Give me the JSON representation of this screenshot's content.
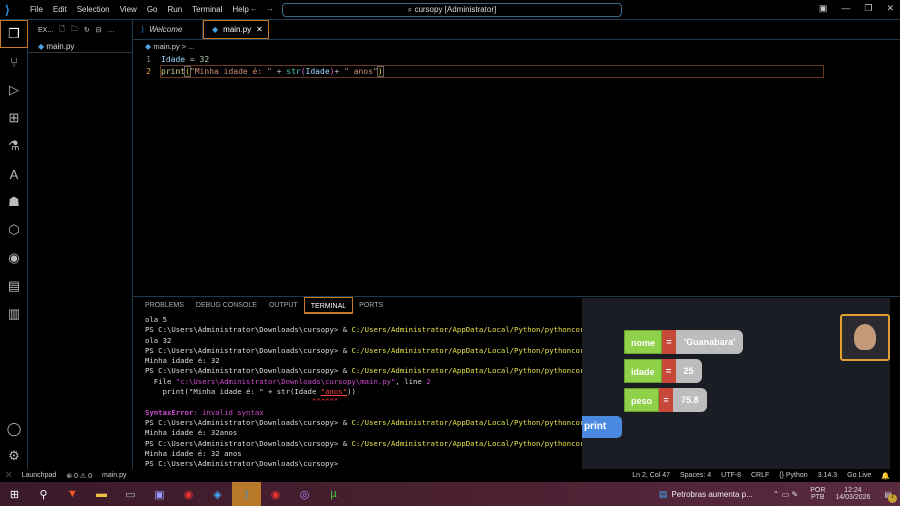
{
  "titlebar": {
    "menu": [
      "File",
      "Edit",
      "Selection",
      "View",
      "Go",
      "Run",
      "Terminal",
      "Help"
    ],
    "search": "cursopy [Administrator]"
  },
  "explorer": {
    "title": "EX...",
    "files": [
      "main.py"
    ]
  },
  "tabs": [
    {
      "label": "Welcome"
    },
    {
      "label": "main.py",
      "active": true
    }
  ],
  "breadcrumb": "main.py > ...",
  "code": {
    "line1_no": "1",
    "line2_no": "2",
    "l1": {
      "var": "Idade",
      "op": " = ",
      "num": "32"
    },
    "l2": {
      "fn": "print",
      "p1": "(",
      "s1": "\"Minha idade é: \"",
      "op": " + ",
      "fn2": "str",
      "p2": "(",
      "var": "Idade",
      "p3": ")",
      "op2": "+ ",
      "s2": "\" anos\"",
      "p4": ")"
    }
  },
  "panel": {
    "tabs": [
      "PROBLEMS",
      "DEBUG CONSOLE",
      "OUTPUT",
      "TERMINAL",
      "PORTS"
    ],
    "active": "TERMINAL"
  },
  "terminal": {
    "prompt": "PS C:\\Users\\Administrator\\Downloads\\cursopy> ",
    "amp": "& ",
    "path": "C:/Users/Administrator/AppData/Local/Python/pythoncore-3.",
    "out1": "ola 5",
    "out2": "ola 32",
    "out3": "Minha idade é: 32",
    "file_pre": "  File ",
    "file_path": "\"c:\\Users\\Administrator\\Downloads\\cursopy\\main.py\"",
    "file_mid": ", line ",
    "file_line": "2",
    "err_code_pre": "    print(\"Minha idade é: \" + str(Idade ",
    "err_code_hl": "\"anos\"",
    "err_code_post": "))",
    "carets": "                                      ^^^^^^",
    "err_name": "SyntaxError",
    "err_msg": ": invalid syntax",
    "out4": "Minha idade é: 32anos",
    "out5": "Minha idade é: 32 anos"
  },
  "overlay": {
    "blocks": [
      {
        "name": "nome",
        "eq": "=",
        "value": "'Guanabara'"
      },
      {
        "name": "idade",
        "eq": "=",
        "value": "25"
      },
      {
        "name": "peso",
        "eq": "=",
        "value": "75.8"
      }
    ],
    "print": "print"
  },
  "status": {
    "left": [
      "Launchpad",
      "⊗ 0 ⚠ 0",
      "main.py"
    ],
    "right": [
      "Ln 2, Col 47",
      "Spaces: 4",
      "UTF-8",
      "CRLF",
      "{} Python",
      "3.14.3",
      "Go Live"
    ]
  },
  "taskbar": {
    "news": "Petrobras aumenta p...",
    "lang1": "POR",
    "lang2": "PTB",
    "time": "12:24",
    "date": "14/03/2026",
    "notif_count": "7"
  },
  "colors": {
    "accent": "#c87a2a",
    "string": "#ce9178",
    "path": "#e5e54a",
    "error": "#d04ad0"
  }
}
